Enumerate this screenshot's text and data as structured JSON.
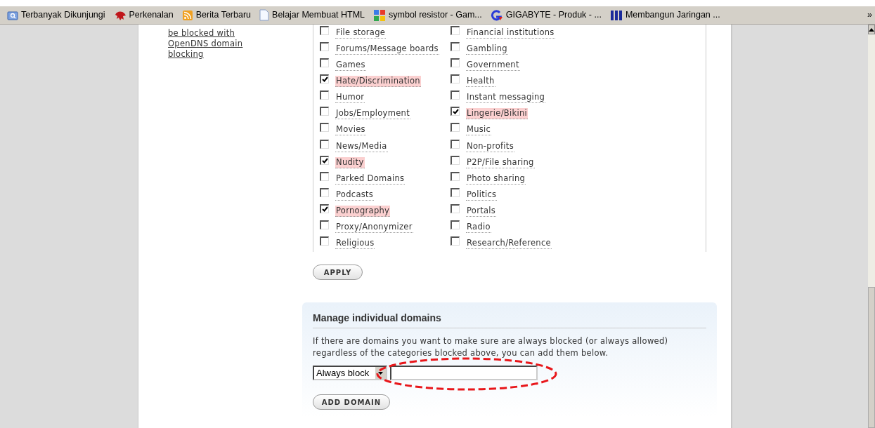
{
  "bookmarks": [
    {
      "label": "Terbanyak Dikunjungi",
      "kind": "folder"
    },
    {
      "label": "Perkenalan",
      "kind": "dino"
    },
    {
      "label": "Berita Terbaru",
      "kind": "feed"
    },
    {
      "label": "Belajar Membuat HTML",
      "kind": "page"
    },
    {
      "label": "symbol resistor - Gam...",
      "kind": "google"
    },
    {
      "label": "GIGABYTE - Produk - ...",
      "kind": "g"
    },
    {
      "label": "Membangun Jaringan ...",
      "kind": "afc"
    }
  ],
  "bookmarks_more": "»",
  "sidebar_link": "be blocked with OpenDNS domain blocking",
  "categories": {
    "left": [
      {
        "label": "File storage",
        "checked": false
      },
      {
        "label": "Forums/Message boards",
        "checked": false
      },
      {
        "label": "Games",
        "checked": false
      },
      {
        "label": "Hate/Discrimination",
        "checked": true
      },
      {
        "label": "Humor",
        "checked": false
      },
      {
        "label": "Jobs/Employment",
        "checked": false
      },
      {
        "label": "Movies",
        "checked": false
      },
      {
        "label": "News/Media",
        "checked": false
      },
      {
        "label": "Nudity",
        "checked": true
      },
      {
        "label": "Parked Domains",
        "checked": false
      },
      {
        "label": "Podcasts",
        "checked": false
      },
      {
        "label": "Pornography",
        "checked": true
      },
      {
        "label": "Proxy/Anonymizer",
        "checked": false
      },
      {
        "label": "Religious",
        "checked": false
      }
    ],
    "right": [
      {
        "label": "Financial institutions",
        "checked": false
      },
      {
        "label": "Gambling",
        "checked": false
      },
      {
        "label": "Government",
        "checked": false
      },
      {
        "label": "Health",
        "checked": false
      },
      {
        "label": "Instant messaging",
        "checked": false
      },
      {
        "label": "Lingerie/Bikini",
        "checked": true
      },
      {
        "label": "Music",
        "checked": false
      },
      {
        "label": "Non-profits",
        "checked": false
      },
      {
        "label": "P2P/File sharing",
        "checked": false
      },
      {
        "label": "Photo sharing",
        "checked": false
      },
      {
        "label": "Politics",
        "checked": false
      },
      {
        "label": "Portals",
        "checked": false
      },
      {
        "label": "Radio",
        "checked": false
      },
      {
        "label": "Research/Reference",
        "checked": false
      }
    ]
  },
  "apply_button": "APPLY",
  "domains_panel": {
    "title": "Manage individual domains",
    "description": "If there are domains you want to make sure are always blocked (or always allowed) regardless of the categories blocked above, you can add them below.",
    "mode_select": "Always block",
    "add_button": "ADD DOMAIN"
  }
}
